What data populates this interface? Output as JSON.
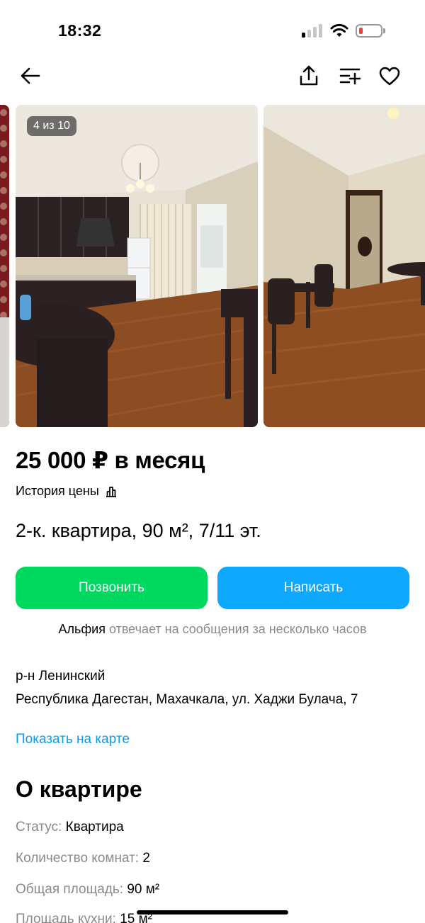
{
  "status_bar": {
    "time": "18:32"
  },
  "gallery": {
    "counter": "4 из 10"
  },
  "listing": {
    "price": "25 000 ₽ в месяц",
    "price_history": "История цены",
    "title": "2-к. квартира, 90 м², 7/11 эт."
  },
  "actions": {
    "call_label": "Позвонить",
    "write_label": "Написать"
  },
  "seller": {
    "name": "Альфия",
    "response_note": " отвечает на сообщения за несколько часов"
  },
  "location": {
    "district": "р-н Ленинский",
    "address": "Республика Дагестан, Махачкала, ул. Хаджи Булача, 7",
    "map_link": "Показать на карте"
  },
  "about": {
    "title": "О квартире",
    "params": [
      {
        "label": "Статус:",
        "value": "Квартира"
      },
      {
        "label": "Количество комнат:",
        "value": "2"
      },
      {
        "label": "Общая площадь:",
        "value": "90 м²"
      },
      {
        "label": "Площадь кухни:",
        "value": "15 м²"
      }
    ]
  },
  "colors": {
    "call": "#00d95f",
    "write": "#0fa8ff",
    "link": "#0a9bf0",
    "muted": "#8a8a8a"
  },
  "icons": [
    "back-arrow-icon",
    "share-icon",
    "compare-list-icon",
    "heart-icon",
    "bar-chart-icon",
    "signal-icon",
    "wifi-icon",
    "battery-icon"
  ]
}
